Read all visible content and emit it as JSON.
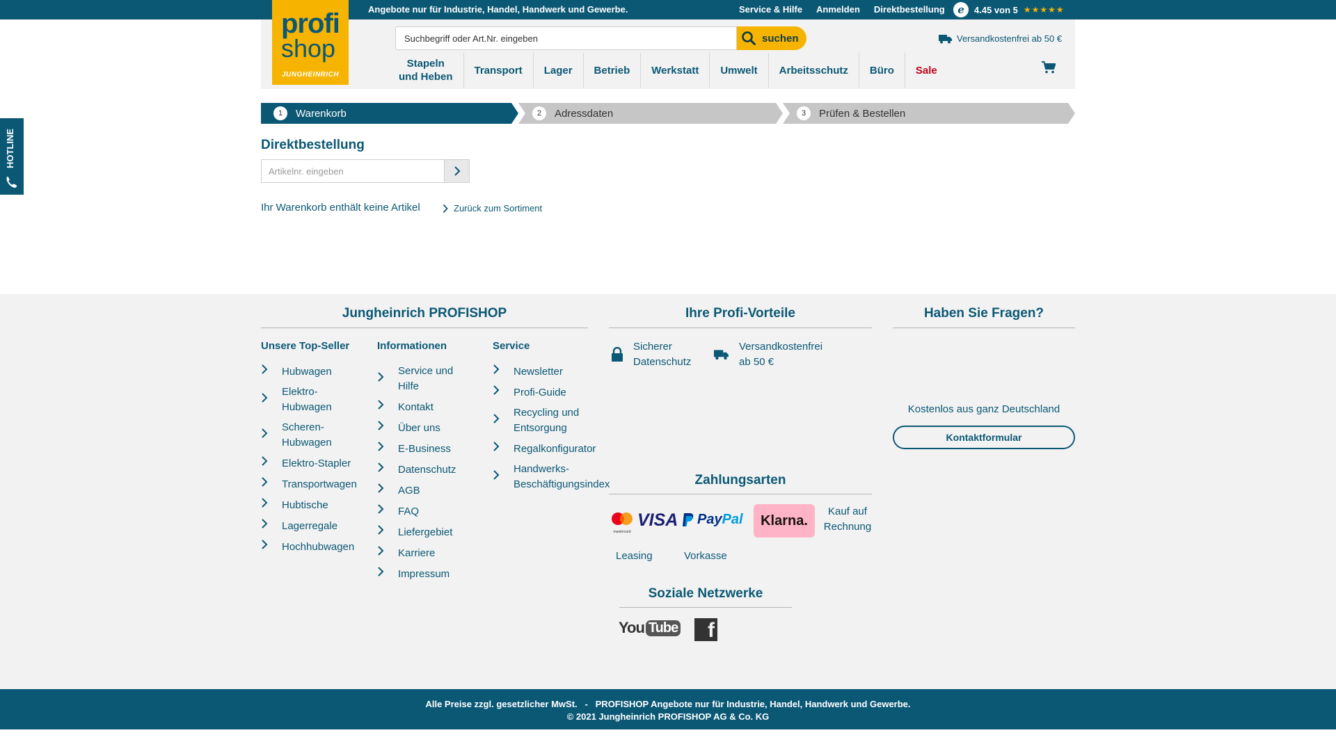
{
  "topbar": {
    "tagline": "Angebote nur für Industrie, Handel, Handwerk und Gewerbe.",
    "links": [
      "Service & Hilfe",
      "Anmelden",
      "Direktbestellung"
    ],
    "rating": "4.45 von 5",
    "rating_stars": "★★★★★",
    "rating_badge": "e"
  },
  "logo": {
    "line1": "profi",
    "line2": "shop",
    "line3": "JUNGHEINRICH"
  },
  "search": {
    "placeholder": "Suchbegriff oder Art.Nr. eingeben",
    "button": "suchen"
  },
  "shipping": "Versandkostenfrei ab 50 €",
  "nav": [
    "Stapeln\nund Heben",
    "Transport",
    "Lager",
    "Betrieb",
    "Werkstatt",
    "Umwelt",
    "Arbeitsschutz",
    "Büro",
    "Sale"
  ],
  "steps": [
    {
      "num": "1",
      "label": "Warenkorb"
    },
    {
      "num": "2",
      "label": "Adressdaten"
    },
    {
      "num": "3",
      "label": "Prüfen & Bestellen"
    }
  ],
  "hotline": "HOTLINE",
  "direct": {
    "title": "Direktbestellung",
    "placeholder": "Artikelnr. eingeben",
    "empty_message": "Ihr Warenkorb enthält keine Artikel",
    "back_link": "Zurück zum Sortiment"
  },
  "footer": {
    "shop_title": "Jungheinrich PROFISHOP",
    "advantages_title": "Ihre Profi-Vorteile",
    "questions_title": "Haben Sie Fragen?",
    "payments_title": "Zahlungsarten",
    "social_title": "Soziale Netzwerke",
    "topseller": {
      "title": "Unsere Top-Seller",
      "items": [
        "Hubwagen",
        "Elektro-\nHubwagen",
        "Scheren-\nHubwagen",
        "Elektro-Stapler",
        "Transportwagen",
        "Hubtische",
        "Lagerregale",
        "Hochhubwagen"
      ]
    },
    "info": {
      "title": "Informationen",
      "items": [
        "Service und\nHilfe",
        "Kontakt",
        "Über uns",
        "E-Business",
        "Datenschutz",
        "AGB",
        "FAQ",
        "Liefergebiet",
        "Karriere",
        "Impressum"
      ]
    },
    "service": {
      "title": "Service",
      "items": [
        "Newsletter",
        "Profi-Guide",
        "Recycling und\nEntsorgung",
        "Regalkonfigurator",
        "Handwerks-\nBeschäftigungsindex"
      ]
    },
    "advantages": [
      "Sicherer\nDatenschutz",
      "Versandkostenfrei\nab 50 €"
    ],
    "kostenlos": "Kostenlos aus ganz Deutschland",
    "kontakt_button": "Kontaktformular",
    "payments": {
      "visa": "VISA",
      "paypal_a": "Pay",
      "paypal_b": "Pal",
      "klarna": "Klarna.",
      "mastercard": "mastercard",
      "rechnung": "Kauf auf\nRechnung",
      "leasing": "Leasing",
      "vorkasse": "Vorkasse"
    },
    "social": {
      "youtube_a": "You",
      "youtube_b": "Tube",
      "facebook": "f"
    }
  },
  "bottom": {
    "line1": "Alle Preise zzgl. gesetzlicher MwSt.   -   PROFISHOP Angebote nur für Industrie, Handel, Handwerk und Gewerbe.",
    "line2": "© 2021 Jungheinrich PROFISHOP AG & Co. KG"
  },
  "colors": {
    "primary": "#0b5875",
    "accent": "#f6b300",
    "sale": "#c0001a",
    "footer_bg": "#f2f2f2",
    "step_inactive": "#c6c6c6"
  }
}
